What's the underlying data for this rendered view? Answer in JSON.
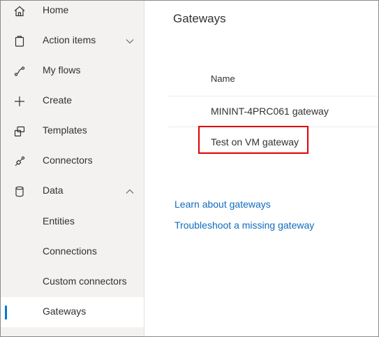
{
  "sidebar": {
    "items": [
      {
        "label": "Home",
        "icon": "home-icon"
      },
      {
        "label": "Action items",
        "icon": "clipboard-icon",
        "chevron": "chevron-down-icon"
      },
      {
        "label": "My flows",
        "icon": "flow-icon"
      },
      {
        "label": "Create",
        "icon": "plus-icon"
      },
      {
        "label": "Templates",
        "icon": "templates-icon"
      },
      {
        "label": "Connectors",
        "icon": "connector-icon"
      },
      {
        "label": "Data",
        "icon": "database-icon",
        "chevron": "chevron-up-icon"
      },
      {
        "label": "Entities"
      },
      {
        "label": "Connections"
      },
      {
        "label": "Custom connectors"
      },
      {
        "label": "Gateways",
        "selected": true
      }
    ]
  },
  "main": {
    "title": "Gateways",
    "table": {
      "header": "Name",
      "rows": [
        "MININT-4PRC061 gateway",
        "Test on VM gateway"
      ]
    },
    "links": [
      "Learn about gateways",
      "Troubleshoot a missing gateway"
    ]
  },
  "colors": {
    "accent": "#0078d4",
    "link": "#0f6cbd",
    "highlight_box": "#e00000"
  }
}
